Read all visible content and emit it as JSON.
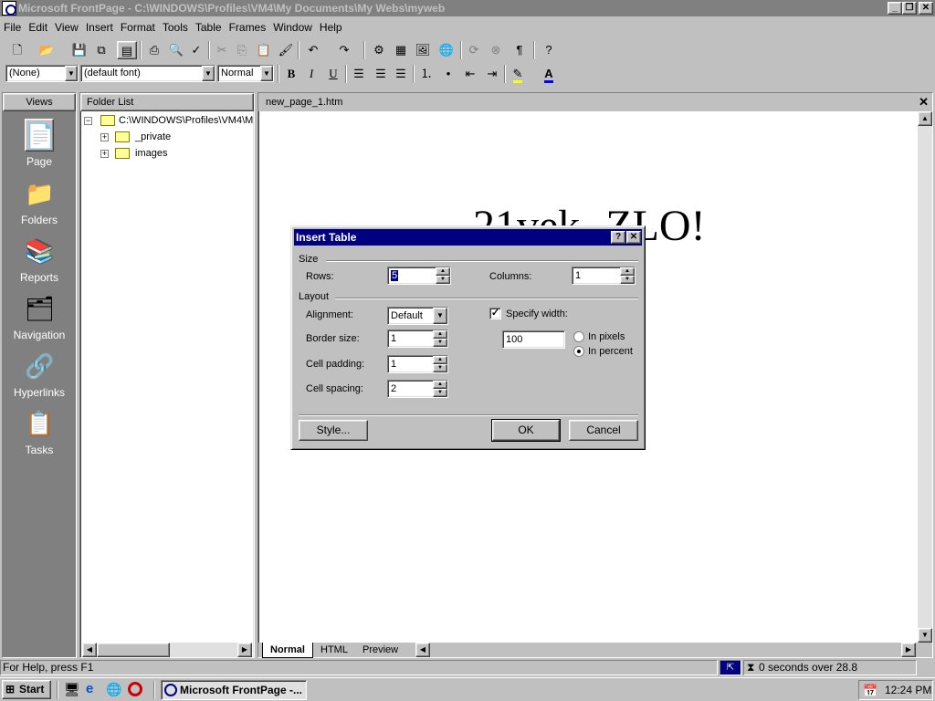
{
  "window": {
    "title": "Microsoft FrontPage - C:\\WINDOWS\\Profiles\\VM4\\My Documents\\My Webs\\myweb",
    "minimize": "_",
    "restore": "❐",
    "close": "✕"
  },
  "menu": [
    "File",
    "Edit",
    "View",
    "Insert",
    "Format",
    "Tools",
    "Table",
    "Frames",
    "Window",
    "Help"
  ],
  "format_toolbar": {
    "style": "(None)",
    "font": "(default font)",
    "size": "Normal",
    "bold": "B",
    "italic": "I",
    "underline": "U"
  },
  "views": {
    "header": "Views",
    "items": [
      {
        "label": "Page",
        "icon": "page-view-icon"
      },
      {
        "label": "Folders",
        "icon": "folders-view-icon"
      },
      {
        "label": "Reports",
        "icon": "reports-view-icon"
      },
      {
        "label": "Navigation",
        "icon": "navigation-view-icon"
      },
      {
        "label": "Hyperlinks",
        "icon": "hyperlinks-view-icon"
      },
      {
        "label": "Tasks",
        "icon": "tasks-view-icon"
      }
    ]
  },
  "folder_list": {
    "header": "Folder List",
    "root": "C:\\WINDOWS\\Profiles\\VM4\\M",
    "children": [
      "_private",
      "images"
    ]
  },
  "editor": {
    "tab": "new_page_1.htm",
    "content": "21vek- ZLO!",
    "view_tabs": [
      "Normal",
      "HTML",
      "Preview"
    ]
  },
  "dialog": {
    "title": "Insert Table",
    "help": "?",
    "close": "✕",
    "size_group": "Size",
    "rows_label": "Rows:",
    "rows_value": "5",
    "columns_label": "Columns:",
    "columns_value": "1",
    "layout_group": "Layout",
    "alignment_label": "Alignment:",
    "alignment_value": "Default",
    "border_label": "Border size:",
    "border_value": "1",
    "padding_label": "Cell padding:",
    "padding_value": "1",
    "spacing_label": "Cell spacing:",
    "spacing_value": "2",
    "specify_width_label": "Specify width:",
    "specify_width_checked": true,
    "width_value": "100",
    "in_pixels": "In pixels",
    "in_percent": "In percent",
    "width_unit": "percent",
    "style_button": "Style...",
    "ok_button": "OK",
    "cancel_button": "Cancel"
  },
  "status": {
    "help": "For Help, press F1",
    "timing": "0 seconds over 28.8"
  },
  "taskbar": {
    "start": "Start",
    "task": "Microsoft FrontPage -...",
    "clock": "12:24 PM"
  }
}
